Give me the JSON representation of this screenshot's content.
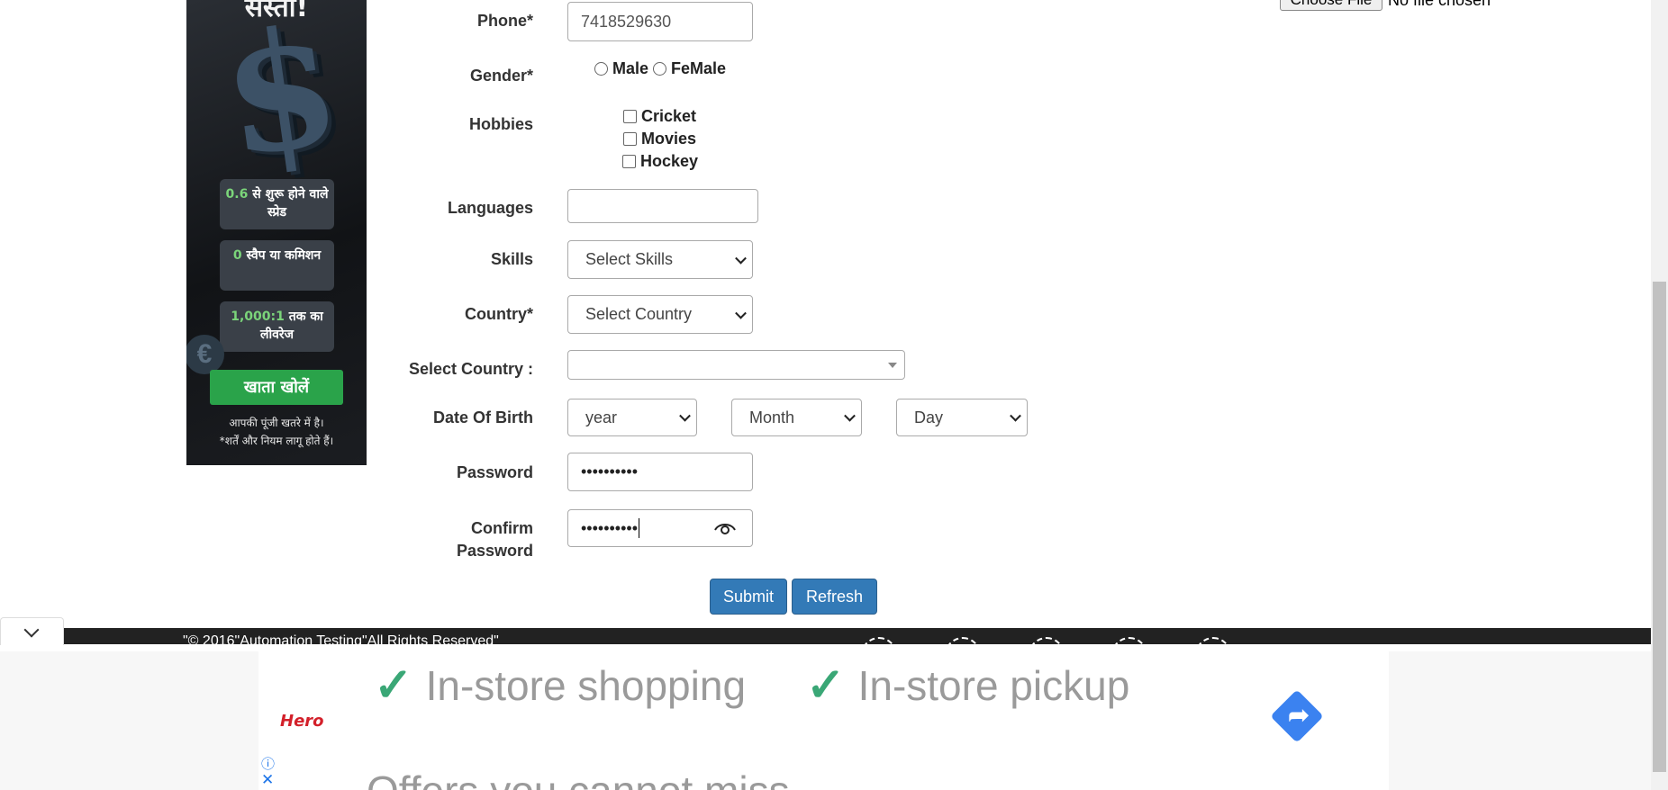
{
  "left_ad": {
    "headline": "सस्ता!",
    "symbol": "$",
    "pill1": {
      "highlight": "0.6",
      "text": "से शुरू होने वाले स्प्रेड"
    },
    "pill2": {
      "highlight": "0",
      "text": "स्वैप या कमिशन"
    },
    "pill3": {
      "highlight": "1,000:1",
      "text": "तक का लीवरेज"
    },
    "euro": "€",
    "cta": "खाता खोलें",
    "disclaimer1": "आपकी पूंजी खतरे में है।",
    "disclaimer2": "*शर्तें और नियम लागू होते हैं।"
  },
  "file_upload": {
    "button": "Choose File",
    "status": "No file chosen"
  },
  "form": {
    "phone": {
      "label": "Phone*",
      "value": "7418529630"
    },
    "gender": {
      "label": "Gender*",
      "options": [
        "Male",
        "FeMale"
      ]
    },
    "hobbies": {
      "label": "Hobbies",
      "options": [
        "Cricket",
        "Movies",
        "Hockey"
      ]
    },
    "languages": {
      "label": "Languages",
      "value": ""
    },
    "skills": {
      "label": "Skills",
      "selected": "Select Skills"
    },
    "country": {
      "label": "Country*",
      "selected": "Select Country"
    },
    "select_country": {
      "label": "Select Country :",
      "selected": ""
    },
    "dob": {
      "label": "Date Of Birth",
      "year": "year",
      "month": "Month",
      "day": "Day"
    },
    "password": {
      "label": "Password",
      "value": "••••••••••"
    },
    "confirm_password": {
      "label_line1": "Confirm",
      "label_line2": "Password",
      "value": "••••••••••"
    },
    "submit": "Submit",
    "refresh": "Refresh"
  },
  "footer": {
    "copyright": "\"© 2016\"Automation Testing\"All Rights Reserved\""
  },
  "bottom_ad": {
    "brand": "Hero",
    "feature1": "In-store shopping",
    "feature2": "In-store pickup",
    "tagline": "Offers you cannot miss",
    "tick": "✓",
    "info": "ⓘ",
    "close": "✕"
  }
}
